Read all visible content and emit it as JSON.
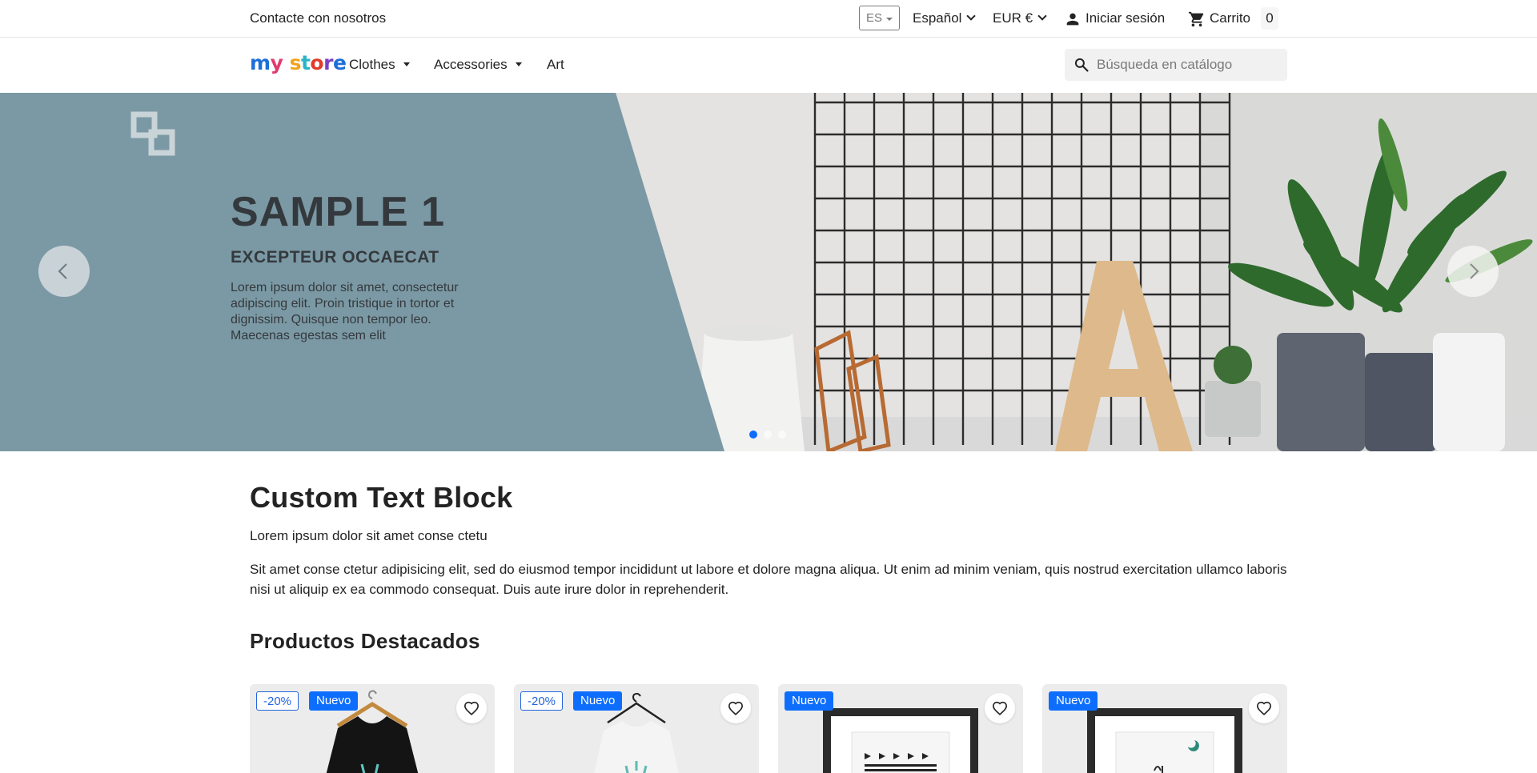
{
  "topbar": {
    "contact_label": "Contacte con nosotros",
    "lang_code": "ES",
    "language_label": "Español",
    "currency_label": "EUR €",
    "signin_label": "Iniciar sesión",
    "cart_label": "Carrito",
    "cart_count": "0"
  },
  "nav": {
    "logo_parts": [
      "m",
      "y",
      " s",
      "t",
      "o",
      "r",
      "e"
    ],
    "items": [
      {
        "label": "Clothes"
      },
      {
        "label": "Accessories"
      },
      {
        "label": "Art"
      }
    ],
    "search_placeholder": "Búsqueda en catálogo"
  },
  "hero": {
    "title": "SAMPLE 1",
    "subtitle": "EXCEPTEUR OCCAECAT",
    "text": "Lorem ipsum dolor sit amet, consectetur adipiscing elit. Proin tristique in tortor et dignissim. Quisque non tempor leo. Maecenas egestas sem elit",
    "slide_count": 3,
    "active_slide": 1,
    "panel_color": "#7b99a4",
    "active_dot_color": "#0d6efd"
  },
  "custom_block": {
    "title": "Custom Text Block",
    "lead": "Lorem ipsum dolor sit amet conse ctetu",
    "body": "Sit amet conse ctetur adipisicing elit, sed do eiusmod tempor incididunt ut labore et dolore magna aliqua. Ut enim ad minim veniam, quis nostrud exercitation ullamco laboris nisi ut aliquip ex ea commodo consequat. Duis aute irure dolor in reprehenderit."
  },
  "featured": {
    "title": "Productos Destacados",
    "products": [
      {
        "discount": "-20%",
        "badge": "Nuevo",
        "image": "black-tshirt-on-hanger"
      },
      {
        "discount": "-20%",
        "badge": "Nuevo",
        "image": "white-sweater-on-hanger"
      },
      {
        "discount": "",
        "badge": "Nuevo",
        "image": "framed-poster-the-best"
      },
      {
        "discount": "",
        "badge": "Nuevo",
        "image": "framed-poster-the-adventure"
      }
    ]
  },
  "colors": {
    "accent": "#0d6efd",
    "text": "#232323",
    "muted": "#7a7a7a"
  }
}
